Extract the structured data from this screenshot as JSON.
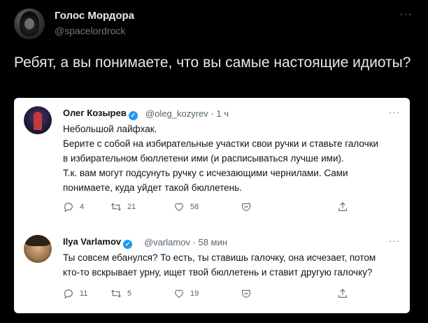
{
  "main_tweet": {
    "author_name": "Голос Мордора",
    "author_handle": "@spacelordrock",
    "more": "···",
    "text": "Ребят, а вы понимаете, что вы самые настоящие идиоты?"
  },
  "quote": {
    "first": {
      "author_name": "Олег Козырев",
      "handle_time": "@oleg_kozyrev · 1 ч",
      "more": "···",
      "lines": [
        "Небольшой лайфхак.",
        "Берите с собой на избирательные участки свои ручки и ставьте галочки",
        "в избирательном бюллетени ими (и расписываться лучше ими).",
        "Т.к. вам могут подсунуть ручку с исчезающими чернилами. Сами",
        "понимаете, куда уйдет такой бюллетень."
      ],
      "replies": "4",
      "retweets": "21",
      "likes": "58"
    },
    "second": {
      "author_name": "Ilya Varlamov",
      "handle_time": "@varlamov · 58 мин",
      "more": "···",
      "lines": [
        "Ты совсем ебанулся? То есть, ты ставишь галочку, она исчезает, потом",
        "кто-то вскрывает урну, ищет твой бюллетень и ставит другую галочку?"
      ],
      "replies": "11",
      "retweets": "5",
      "likes": "19"
    }
  },
  "icons": {
    "verified": "verified-badge-icon",
    "reply": "reply-icon",
    "retweet": "retweet-icon",
    "like": "heart-icon",
    "analytics": "shield-icon",
    "share": "share-icon"
  },
  "colors": {
    "background": "#000000",
    "card": "#ffffff",
    "verified": "#1d9bf0",
    "secondary_text": "#536471"
  }
}
